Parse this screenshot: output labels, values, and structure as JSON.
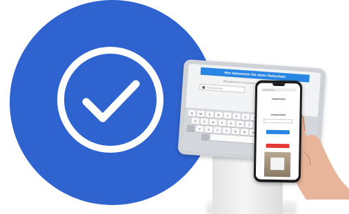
{
  "scene": {
    "check_circle": {
      "color": "#2f63cf",
      "icon": "check-icon"
    },
    "tablet": {
      "banner": "Hier bekommen Sie einen Parkschein",
      "subtitle": "Bitte geben Sie Ihr Kennzeichen ein",
      "field_placeholder": "KENNZEICHEN",
      "keyboard_rows": [
        [
          "Q",
          "W",
          "E",
          "R",
          "T",
          "Z",
          "U",
          "I",
          "O",
          "P"
        ],
        [
          "A",
          "S",
          "D",
          "F",
          "G",
          "H",
          "J",
          "K",
          "L"
        ],
        [
          "Y",
          "X",
          "C",
          "V",
          "B",
          "N",
          "M"
        ]
      ]
    },
    "phone": {
      "url": "parkschein.de",
      "heading": "PARKSCHEIN",
      "section": "KENNZEICHEN",
      "input_placeholder": "",
      "primary_button": "",
      "secondary_label": "",
      "danger_button": "",
      "accent_blue": "#2a86e5",
      "accent_red": "#e53935"
    }
  }
}
